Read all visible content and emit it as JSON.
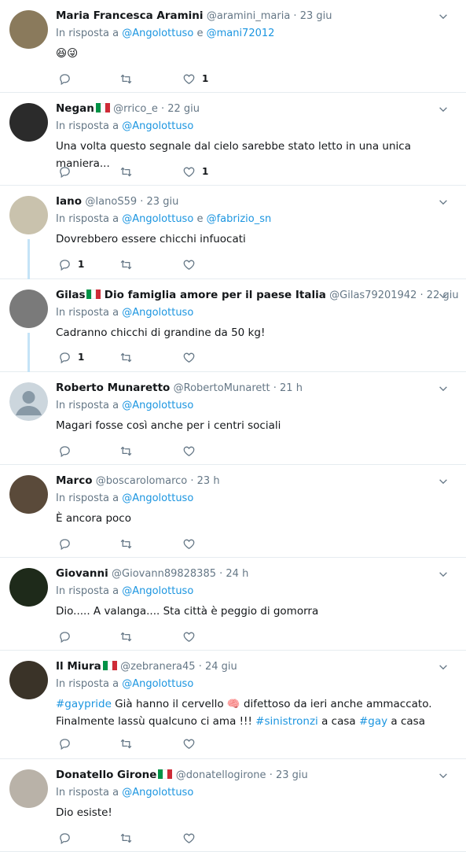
{
  "labels": {
    "in_reply_to": "In risposta a",
    "and": "e"
  },
  "tweets": [
    {
      "name": "Maria Francesca Aramini",
      "flag": false,
      "name_suffix": "",
      "handle": "@aramini_maria",
      "time": "23 giu",
      "mentions": [
        "@Angolottuso",
        "@mani72012"
      ],
      "text_segments": [
        {
          "t": "😆😜",
          "h": false
        }
      ],
      "reply_count": "",
      "like_count": "1",
      "avatar_color": "#8a7a5c",
      "thread_line": false
    },
    {
      "name": "Negan",
      "flag": true,
      "name_suffix": "",
      "handle": "@rrico_e",
      "time": "22 giu",
      "mentions": [
        "@Angolottuso"
      ],
      "text_segments": [
        {
          "t": "Una volta questo segnale dal cielo sarebbe stato letto in una unica maniera...",
          "h": false
        }
      ],
      "reply_count": "",
      "like_count": "1",
      "avatar_color": "#2b2b2b",
      "thread_line": false
    },
    {
      "name": "Iano",
      "flag": false,
      "name_suffix": "",
      "handle": "@IanoS59",
      "time": "23 giu",
      "mentions": [
        "@Angolottuso",
        "@fabrizio_sn"
      ],
      "text_segments": [
        {
          "t": "Dovrebbero essere chicchi infuocati",
          "h": false
        }
      ],
      "reply_count": "1",
      "like_count": "",
      "avatar_color": "#c9c2ad",
      "thread_line": true
    },
    {
      "name": "Gilas",
      "flag": true,
      "name_suffix": "Dio famiglia amore per il paese Italia",
      "handle": "@Gilas79201942",
      "time": "22 giu",
      "mentions": [
        "@Angolottuso"
      ],
      "text_segments": [
        {
          "t": "Cadranno chicchi di grandine da 50 kg!",
          "h": false
        }
      ],
      "reply_count": "1",
      "like_count": "",
      "avatar_color": "#7a7a7a",
      "thread_line": true
    },
    {
      "name": "Roberto Munaretto",
      "flag": false,
      "name_suffix": "",
      "handle": "@RobertoMunarett",
      "time": "21 h",
      "mentions": [
        "@Angolottuso"
      ],
      "text_segments": [
        {
          "t": "Magari fosse così anche per i centri sociali",
          "h": false
        }
      ],
      "reply_count": "",
      "like_count": "",
      "avatar_color": "#ccd6dd",
      "thread_line": false
    },
    {
      "name": "Marco",
      "flag": false,
      "name_suffix": "",
      "handle": "@boscarolomarco",
      "time": "23 h",
      "mentions": [
        "@Angolottuso"
      ],
      "text_segments": [
        {
          "t": "È ancora poco",
          "h": false
        }
      ],
      "reply_count": "",
      "like_count": "",
      "avatar_color": "#5a4a3a",
      "thread_line": false
    },
    {
      "name": "Giovanni",
      "flag": false,
      "name_suffix": "",
      "handle": "@Giovann89828385",
      "time": "24 h",
      "mentions": [
        "@Angolottuso"
      ],
      "text_segments": [
        {
          "t": "Dio..... A valanga.... Sta città è peggio di gomorra",
          "h": false
        }
      ],
      "reply_count": "",
      "like_count": "",
      "avatar_color": "#1e2a1a",
      "thread_line": false
    },
    {
      "name": "Il Miura",
      "flag": true,
      "name_suffix": "",
      "handle": "@zebranera45",
      "time": "24 giu",
      "mentions": [
        "@Angolottuso"
      ],
      "text_segments": [
        {
          "t": "#gaypride",
          "h": true
        },
        {
          "t": " Già hanno il cervello 🧠 difettoso da ieri anche ammaccato. Finalmente lassù qualcuno ci ama !!! ",
          "h": false
        },
        {
          "t": "#sinistronzi",
          "h": true
        },
        {
          "t": " a casa ",
          "h": false
        },
        {
          "t": "#gay",
          "h": true
        },
        {
          "t": " a casa",
          "h": false
        }
      ],
      "reply_count": "",
      "like_count": "",
      "avatar_color": "#3a3328",
      "thread_line": false
    },
    {
      "name": "Donatello Girone",
      "flag": true,
      "name_suffix": "",
      "handle": "@donatellogirone",
      "time": "23 giu",
      "mentions": [
        "@Angolottuso"
      ],
      "text_segments": [
        {
          "t": "Dio esiste!",
          "h": false
        }
      ],
      "reply_count": "",
      "like_count": "",
      "avatar_color": "#b9b2a8",
      "thread_line": false
    }
  ]
}
